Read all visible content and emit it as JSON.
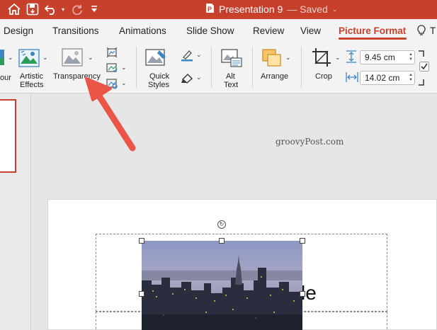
{
  "titlebar": {
    "document_title": "Presentation 9",
    "save_status": "— Saved",
    "icons": [
      "home-icon",
      "save-icon",
      "undo-icon",
      "redo-icon",
      "customize-quick-access-icon",
      "powerpoint-file-icon"
    ]
  },
  "tabs": [
    {
      "label": "Design"
    },
    {
      "label": "Transitions"
    },
    {
      "label": "Animations"
    },
    {
      "label": "Slide Show"
    },
    {
      "label": "Review"
    },
    {
      "label": "View"
    },
    {
      "label": "Picture Format",
      "active": true
    },
    {
      "label": "T"
    }
  ],
  "ribbon": {
    "color_label": "our",
    "artistic_effects_line1": "Artistic",
    "artistic_effects_line2": "Effects",
    "transparency_label": "Transparency",
    "quick_styles_line1": "Quick",
    "quick_styles_line2": "Styles",
    "alt_text_line1": "Alt",
    "alt_text_line2": "Text",
    "arrange_label": "Arrange",
    "crop_label": "Crop",
    "height_value": "9.45 cm",
    "width_value": "14.02 cm"
  },
  "workspace": {
    "watermark": "groovyPost.com",
    "title_fragment": "le"
  },
  "colors": {
    "accent": "#c7402c",
    "arrow": "#ea5548"
  }
}
